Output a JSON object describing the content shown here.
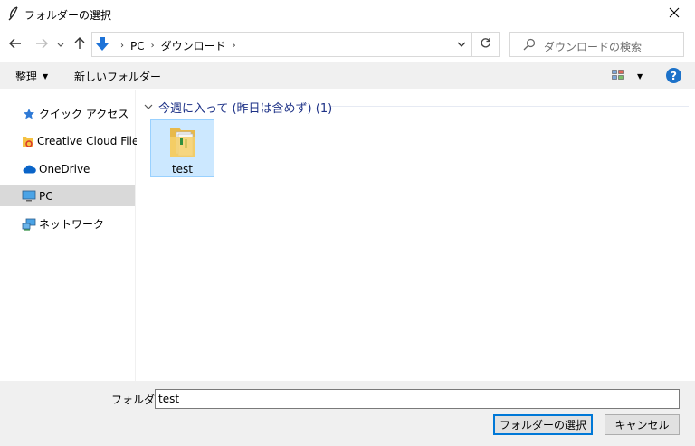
{
  "window": {
    "title": "フォルダーの選択",
    "app_icon": "feather-icon",
    "close_icon": "close-icon"
  },
  "nav": {
    "back_icon": "arrow-left-icon",
    "forward_icon": "arrow-right-icon",
    "recent_icon": "chevron-down-icon",
    "up_icon": "arrow-up-icon",
    "breadcrumb_icon": "download-arrow-icon",
    "breadcrumbs": [
      "PC",
      "ダウンロード"
    ],
    "refresh_icon": "refresh-icon",
    "search_placeholder": "ダウンロードの検索"
  },
  "commands": {
    "organize": "整理",
    "new_folder": "新しいフォルダー",
    "view_icon": "view-options-icon",
    "help_label": "?"
  },
  "sidebar": {
    "items": [
      {
        "label": "クイック アクセス",
        "icon": "star-icon",
        "selected": false
      },
      {
        "label": "Creative Cloud Files",
        "icon": "creative-cloud-icon",
        "selected": false
      },
      {
        "label": "OneDrive",
        "icon": "cloud-icon",
        "selected": false
      },
      {
        "label": "PC",
        "icon": "monitor-icon",
        "selected": true
      },
      {
        "label": "ネットワーク",
        "icon": "network-icon",
        "selected": false
      }
    ]
  },
  "content": {
    "group_label": "今週に入って (昨日は含めず) (1)",
    "items": [
      {
        "name": "test",
        "icon": "folder-icon",
        "selected": true
      }
    ]
  },
  "footer": {
    "folder_label": "フォルダー:",
    "folder_value": "test",
    "select_button": "フォルダーの選択",
    "cancel_button": "キャンセル"
  },
  "colors": {
    "accent": "#0078d7",
    "selection_fill": "#cce8ff",
    "selection_border": "#99d1ff",
    "group_header": "#1e3287",
    "chrome": "#f0f0f0"
  }
}
